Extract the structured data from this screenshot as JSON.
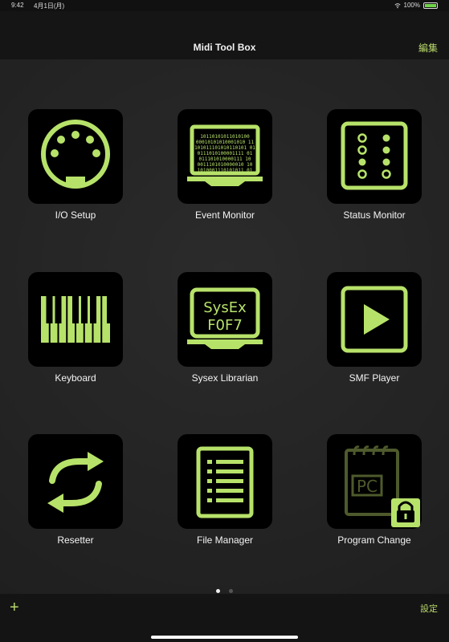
{
  "status_bar": {
    "time": "9:42",
    "date": "4月1日(月)",
    "battery": "100%"
  },
  "nav": {
    "title": "Midi Tool Box",
    "edit_label": "編集"
  },
  "tiles": [
    {
      "label": "I/O Setup"
    },
    {
      "label": "Event Monitor"
    },
    {
      "label": "Status Monitor"
    },
    {
      "label": "Keyboard"
    },
    {
      "label": "Sysex Librarian"
    },
    {
      "label": "SMF Player"
    },
    {
      "label": "Resetter"
    },
    {
      "label": "File Manager"
    },
    {
      "label": "Program Change"
    }
  ],
  "icon_text": {
    "event_monitor_lines": [
      "10110101011010100",
      "00010101010001010 11",
      "101011101010110101 01",
      "0111010100001111 01",
      "011101010000111 10",
      "0011101010000010 10",
      "1010001110101011 01"
    ],
    "sysex_top": "SysEx",
    "sysex_bottom": "F0F7",
    "program_change": "PC"
  },
  "bottom_bar": {
    "settings_label": "設定"
  },
  "colors": {
    "accent": "#b8d86a",
    "icon_green": "#b7e26a",
    "background": "#242424",
    "bar": "#141414"
  }
}
